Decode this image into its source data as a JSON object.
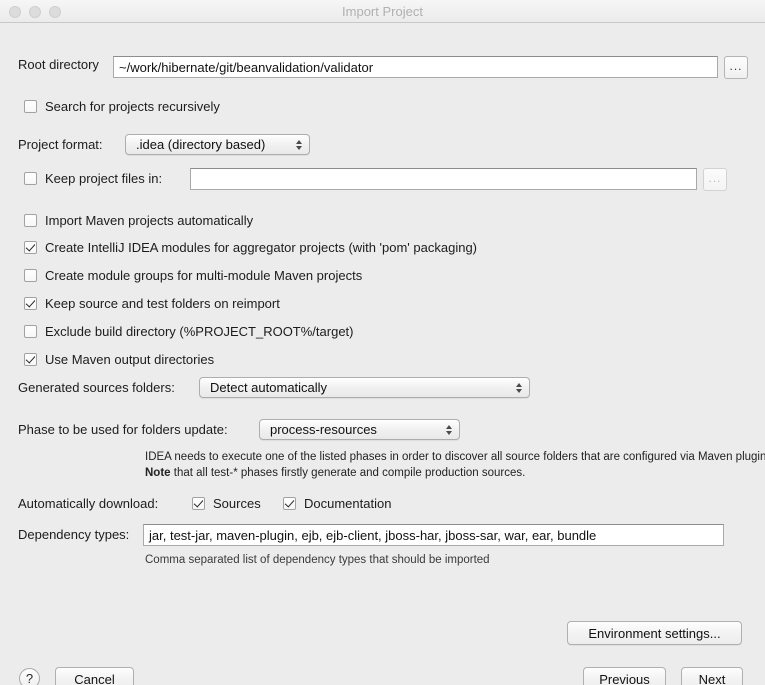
{
  "window": {
    "title": "Import Project",
    "traffic_lights": [
      "close-button",
      "minimize-button",
      "zoom-button"
    ]
  },
  "root_directory": {
    "label": "Root directory",
    "value": "~/work/hibernate/git/beanvalidation/validator",
    "browse_label": "..."
  },
  "search_recursive": {
    "label": "Search for projects recursively",
    "checked": false
  },
  "project_format": {
    "label": "Project format:",
    "value": ".idea (directory based)"
  },
  "keep_project_files": {
    "label": "Keep project files in:",
    "checked": false,
    "value": "",
    "browse_label": "..."
  },
  "options": [
    {
      "label": "Import Maven projects automatically",
      "checked": false
    },
    {
      "label": "Create IntelliJ IDEA modules for aggregator projects (with 'pom' packaging)",
      "checked": true
    },
    {
      "label": "Create module groups for multi-module Maven projects",
      "checked": false
    },
    {
      "label": "Keep source and test folders on reimport",
      "checked": true
    },
    {
      "label": "Exclude build directory (%PROJECT_ROOT%/target)",
      "checked": false
    },
    {
      "label": "Use Maven output directories",
      "checked": true
    }
  ],
  "generated_sources": {
    "label": "Generated sources folders:",
    "value": "Detect automatically"
  },
  "phase_update": {
    "label": "Phase to be used for folders update:",
    "value": "process-resources"
  },
  "note": {
    "line1": "IDEA needs to execute one of the listed phases in order to discover all source folders that are configured via Maven plugins.",
    "line2_bold": "Note",
    "line2_rest": " that all test-* phases firstly generate and compile production sources."
  },
  "auto_download": {
    "label": "Automatically download:",
    "sources": {
      "label": "Sources",
      "checked": true
    },
    "documentation": {
      "label": "Documentation",
      "checked": true
    }
  },
  "dependency_types": {
    "label": "Dependency types:",
    "value": "jar, test-jar, maven-plugin, ejb, ejb-client, jboss-har, jboss-sar, war, ear, bundle",
    "hint": "Comma separated list of dependency types that should be imported"
  },
  "buttons": {
    "environment_settings": "Environment settings...",
    "help": "?",
    "cancel": "Cancel",
    "previous": "Previous",
    "next": "Next"
  }
}
